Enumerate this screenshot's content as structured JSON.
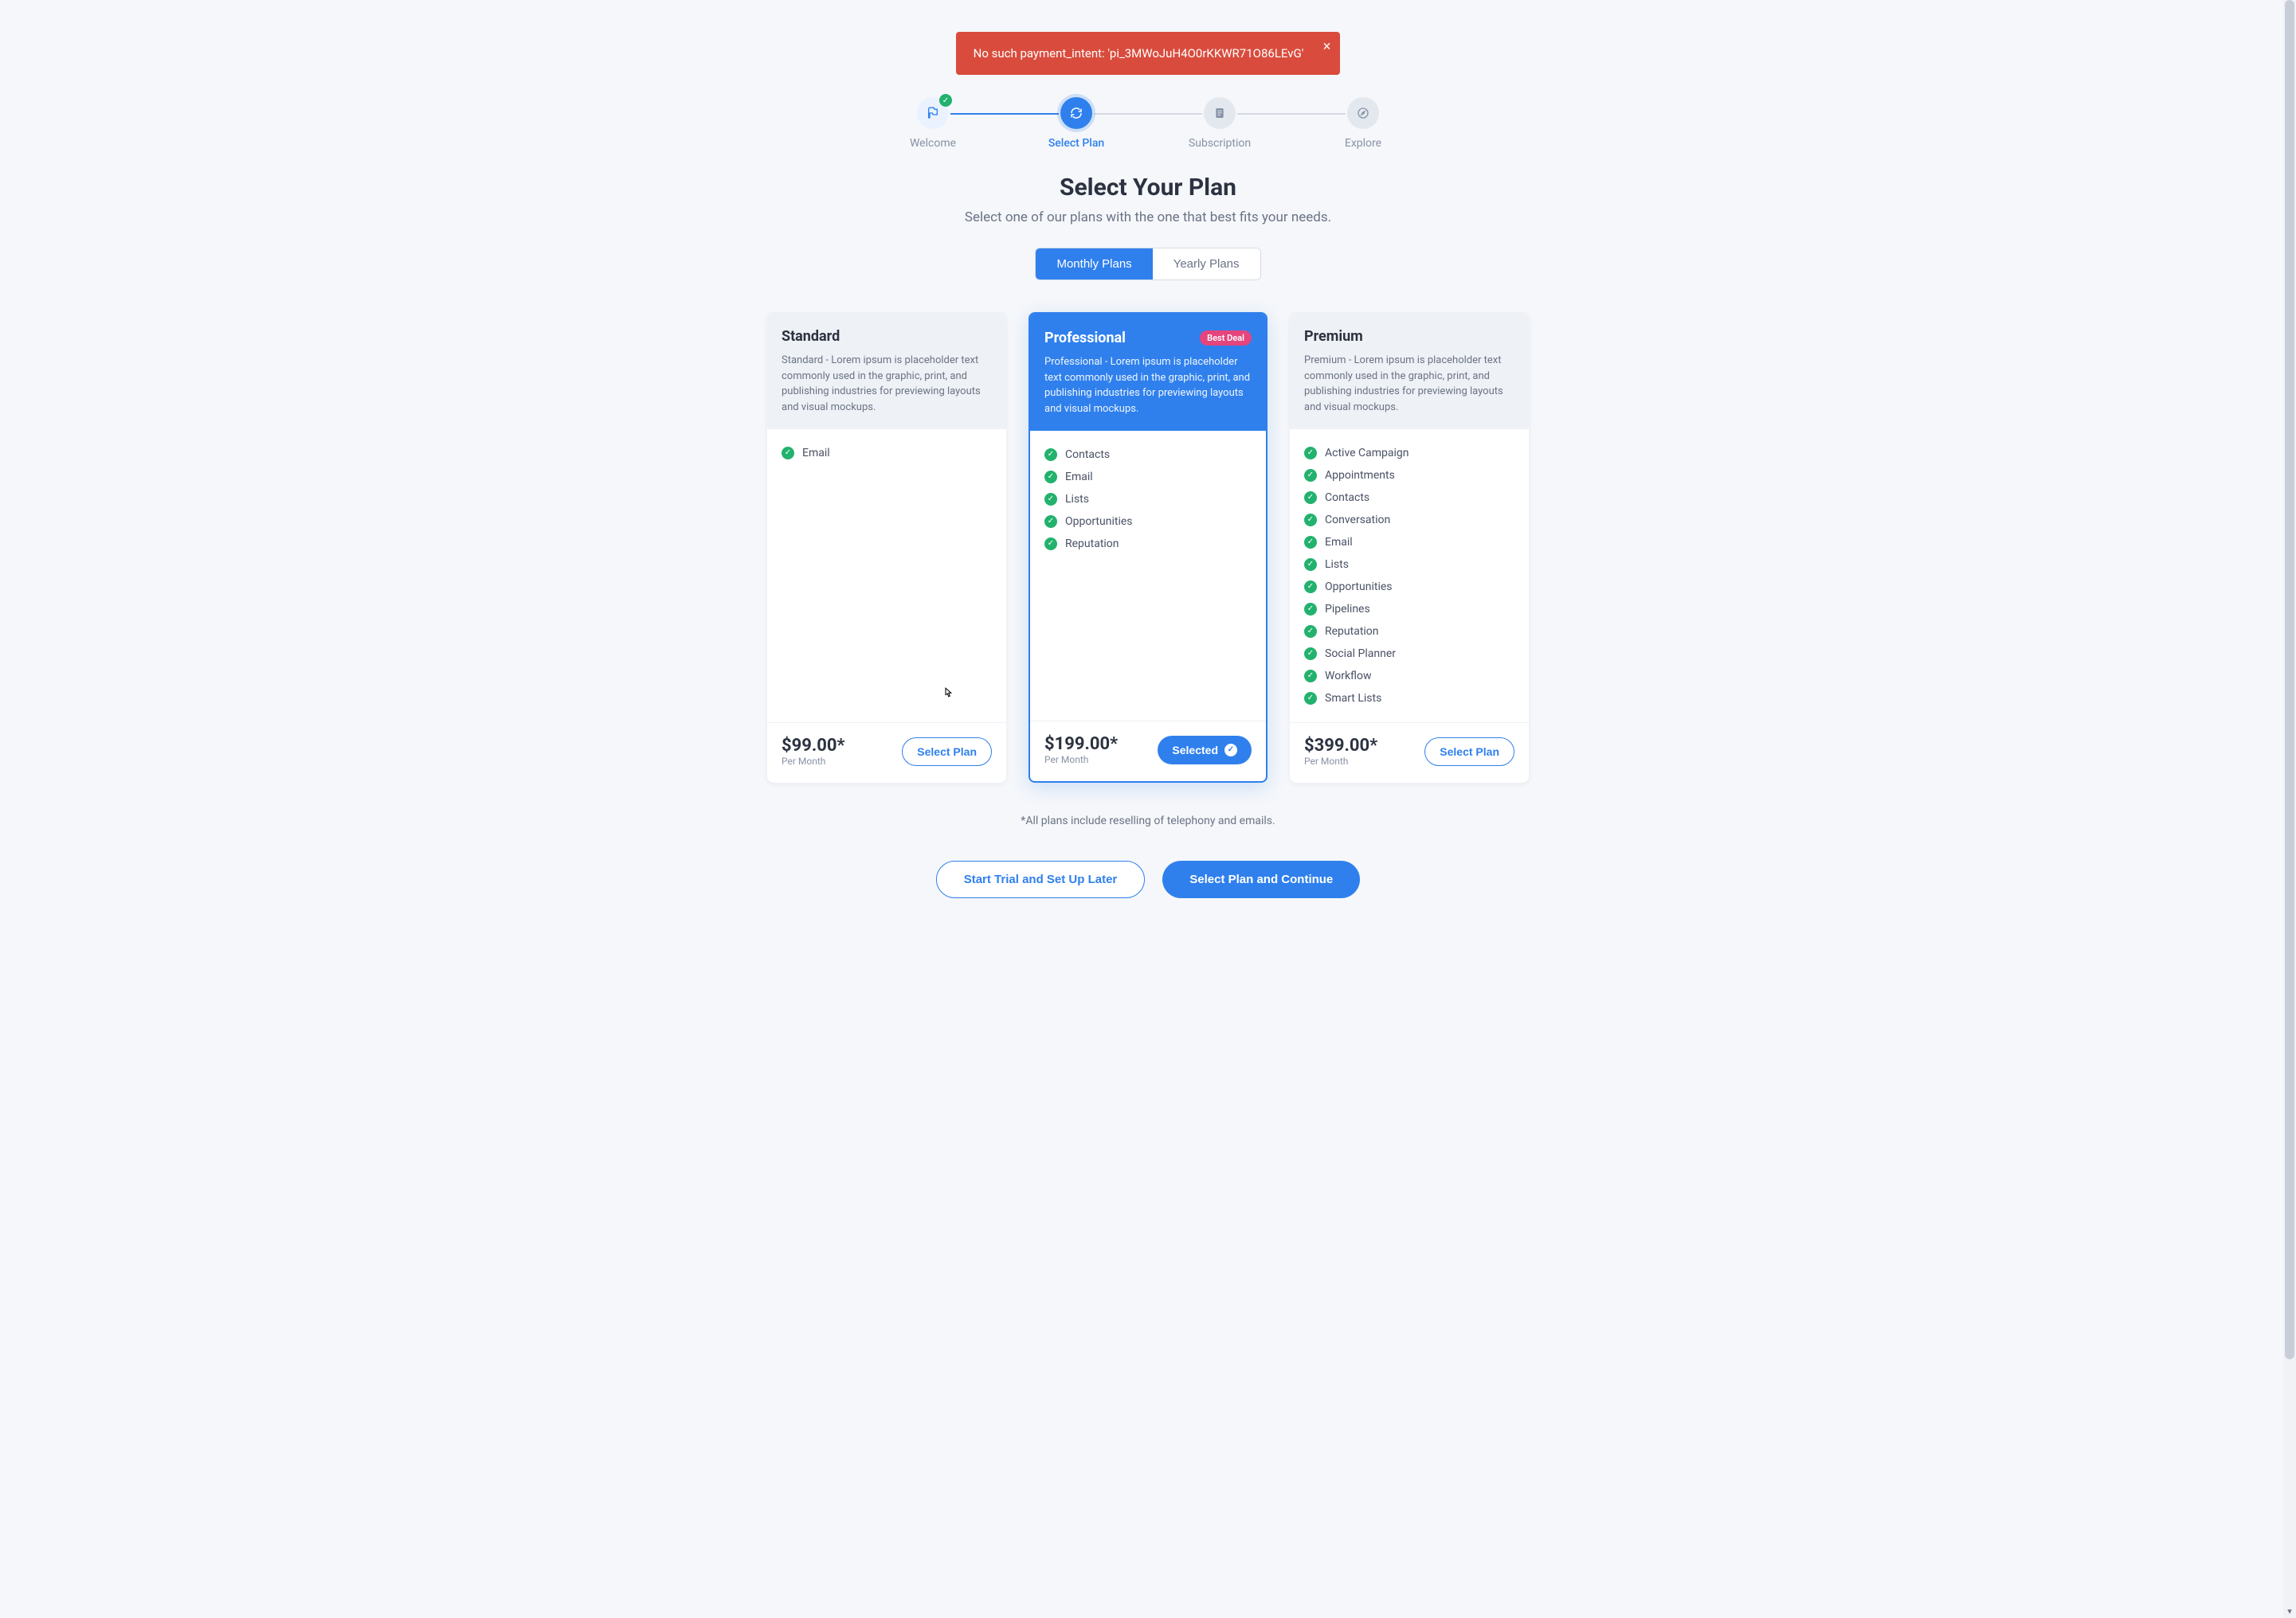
{
  "alert": {
    "message": "No such payment_intent: 'pi_3MWoJuH4O0rKKWR71O86LEvG'"
  },
  "stepper": {
    "items": [
      {
        "label": "Welcome",
        "state": "completed",
        "icon": "flag"
      },
      {
        "label": "Select Plan",
        "state": "active",
        "icon": "refresh"
      },
      {
        "label": "Subscription",
        "state": "upcoming",
        "icon": "document"
      },
      {
        "label": "Explore",
        "state": "upcoming",
        "icon": "compass"
      }
    ]
  },
  "heading": {
    "title": "Select Your Plan",
    "subtitle": "Select one of our plans with the one that best fits your needs."
  },
  "billing_toggle": {
    "monthly": "Monthly Plans",
    "yearly": "Yearly Plans",
    "active": "monthly"
  },
  "plans": [
    {
      "key": "standard",
      "name": "Standard",
      "description": "Standard - Lorem ipsum is placeholder text commonly used in the graphic, print, and publishing industries for previewing layouts and visual mockups.",
      "features": [
        "Email"
      ],
      "price": "$99.00*",
      "period": "Per Month",
      "cta": "Select Plan",
      "selected": false,
      "badge": null
    },
    {
      "key": "professional",
      "name": "Professional",
      "description": "Professional - Lorem ipsum is placeholder text commonly used in the graphic, print, and publishing industries for previewing layouts and visual mockups.",
      "features": [
        "Contacts",
        "Email",
        "Lists",
        "Opportunities",
        "Reputation"
      ],
      "price": "$199.00*",
      "period": "Per Month",
      "cta": "Selected",
      "selected": true,
      "badge": "Best Deal"
    },
    {
      "key": "premium",
      "name": "Premium",
      "description": "Premium - Lorem ipsum is placeholder text commonly used in the graphic, print, and publishing industries for previewing layouts and visual mockups.",
      "features": [
        "Active Campaign",
        "Appointments",
        "Contacts",
        "Conversation",
        "Email",
        "Lists",
        "Opportunities",
        "Pipelines",
        "Reputation",
        "Social Planner",
        "Workflow",
        "Smart Lists"
      ],
      "price": "$399.00*",
      "period": "Per Month",
      "cta": "Select Plan",
      "selected": false,
      "badge": null
    }
  ],
  "footnote": "*All plans include reselling of telephony and emails.",
  "actions": {
    "secondary": "Start Trial and Set Up Later",
    "primary": "Select Plan and Continue"
  },
  "colors": {
    "accent": "#2f80ed",
    "danger": "#d94c3d",
    "success": "#22b26d",
    "badge_pink": "#e6447d"
  }
}
